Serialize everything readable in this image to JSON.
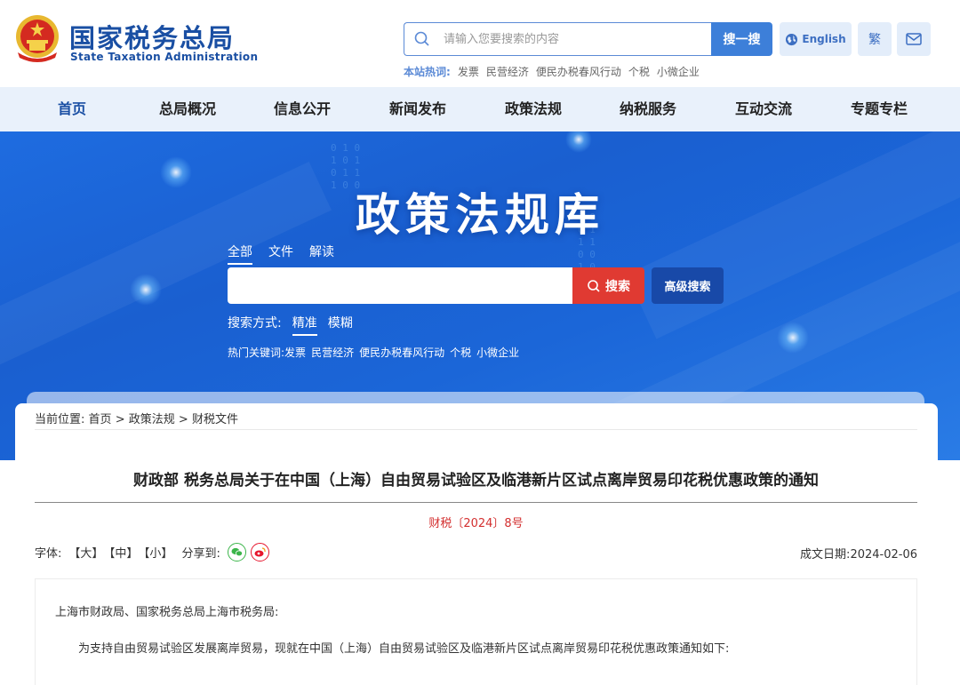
{
  "header": {
    "logo_cn": "国家税务总局",
    "logo_en": "State Taxation Administration",
    "search": {
      "placeholder": "请输入您要搜索的内容",
      "value": "",
      "button": "搜一搜"
    },
    "english_label": "English",
    "traditional_label": "繁",
    "hot_label": "本站热词:",
    "hot_words": [
      "发票",
      "民营经济",
      "便民办税春风行动",
      "个税",
      "小微企业"
    ]
  },
  "nav": {
    "items": [
      "首页",
      "总局概况",
      "信息公开",
      "新闻发布",
      "政策法规",
      "纳税服务",
      "互动交流",
      "专题专栏"
    ],
    "active_index": 0
  },
  "banner": {
    "title": "政策法规库",
    "tabs": [
      "全部",
      "文件",
      "解读"
    ],
    "active_tab": 0,
    "search_value": "",
    "search_button": "搜索",
    "advanced_button": "高级搜索",
    "mode_label": "搜索方式:",
    "modes": [
      "精准",
      "模糊"
    ],
    "active_mode": 0,
    "hot_label": "热门关键词:",
    "hot_words": [
      "发票",
      "民营经济",
      "便民办税春风行动",
      "个税",
      "小微企业"
    ]
  },
  "article": {
    "breadcrumb_label": "当前位置:",
    "breadcrumb": [
      "首页",
      "政策法规",
      "财税文件"
    ],
    "breadcrumb_sep": ">",
    "title": "财政部 税务总局关于在中国（上海）自由贸易试验区及临港新片区试点离岸贸易印花税优惠政策的通知",
    "doc_number": "财税〔2024〕8号",
    "font_label": "字体:",
    "font_sizes": [
      "【大】",
      "【中】",
      "【小】"
    ],
    "share_label": "分享到:",
    "date_label": "成文日期:",
    "date": "2024-02-06",
    "salutation": "上海市财政局、国家税务总局上海市税务局:",
    "paragraph": "为支持自由贸易试验区发展离岸贸易，现就在中国（上海）自由贸易试验区及临港新片区试点离岸贸易印花税优惠政策通知如下:"
  },
  "colors": {
    "brand_blue": "#1a4fa3",
    "nav_bg": "#e9f1fb",
    "banner_blue": "#1a5fd0",
    "search_red": "#e03a32",
    "doc_number_red": "#d32f2f",
    "wechat_green": "#3bb54a",
    "weibo_red": "#e6162d"
  },
  "icons": [
    "national-emblem-icon",
    "search-icon",
    "globe-icon",
    "mail-icon",
    "wechat-icon",
    "weibo-icon"
  ]
}
